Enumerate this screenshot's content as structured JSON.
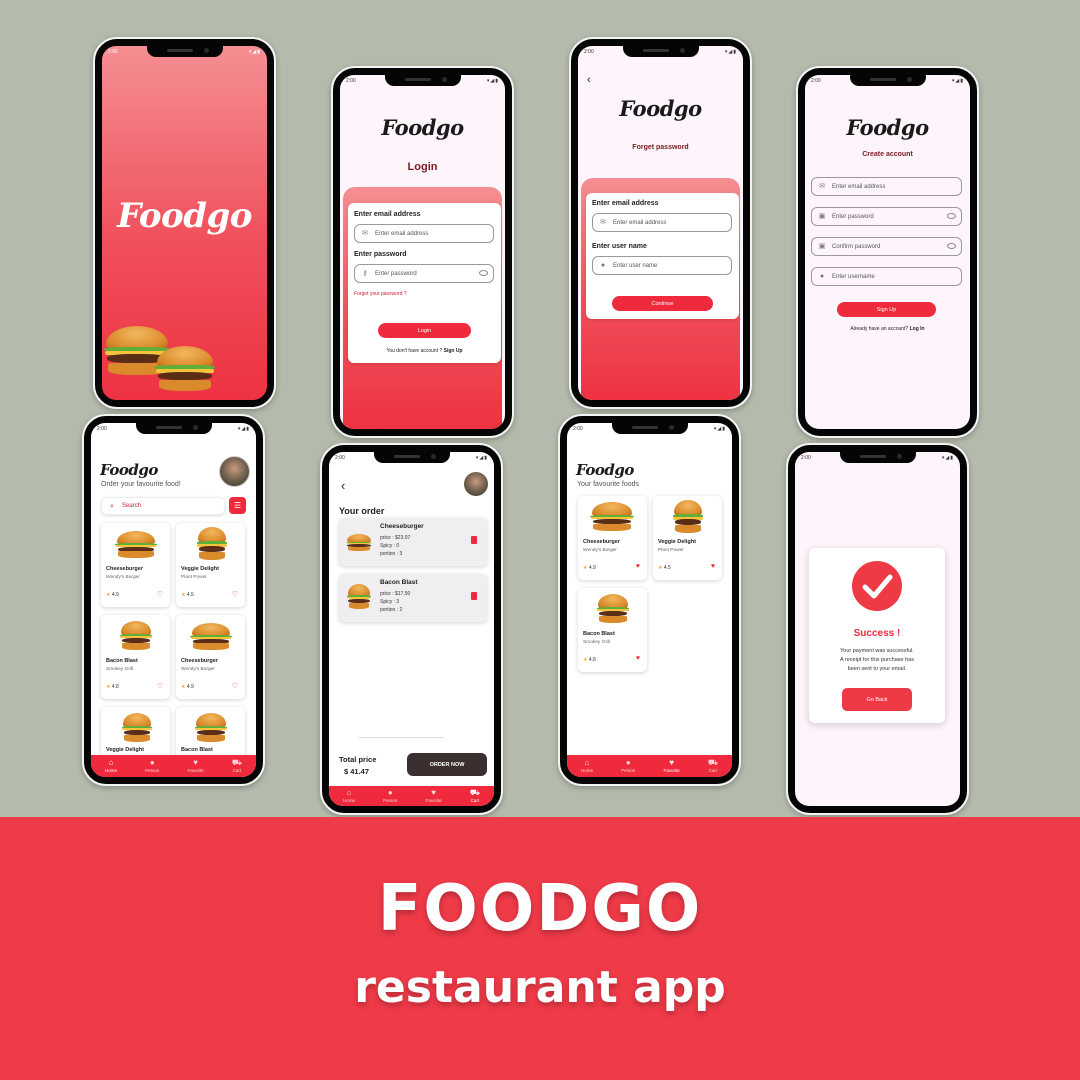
{
  "status_time": "2:00",
  "splash": {
    "logo": "Foodgo"
  },
  "login": {
    "logo": "Foodgo",
    "title": "Login",
    "email_label": "Enter email address",
    "email_placeholder": "Enter email address",
    "password_label": "Enter password",
    "password_placeholder": "Enter password",
    "forgot": "Forget your password ?",
    "button": "Login",
    "no_account": "You don't have account ?",
    "signup": "Sign Up"
  },
  "forget": {
    "logo": "Foodgo",
    "title": "Forget password",
    "email_label": "Enter email address",
    "email_placeholder": "Enter email address",
    "user_label": "Enter user name",
    "user_placeholder": "Enter user name",
    "button": "Continue"
  },
  "signup": {
    "logo": "Foodgo",
    "title": "Create account",
    "email_placeholder": "Enter email address",
    "password_placeholder": "Enter password",
    "confirm_placeholder": "Confirm password",
    "username_placeholder": "Enter username",
    "button": "Sign Up",
    "have_account": "Already have an account?",
    "login": "Log In"
  },
  "home": {
    "logo": "Foodgo",
    "subtitle": "Order your favourite food!",
    "search_placeholder": "Search",
    "items": [
      {
        "name": "Cheeseburger",
        "sub": "Wendy's Burger",
        "rating": "4.9"
      },
      {
        "name": "Veggie Delight",
        "sub": "Plant Power",
        "rating": "4.5"
      },
      {
        "name": "Bacon Blast",
        "sub": "Smokey Grill",
        "rating": "4.8"
      },
      {
        "name": "Cheeseburger",
        "sub": "Wendy's Burger",
        "rating": "4.9"
      },
      {
        "name": "Veggie Delight",
        "sub": ""
      },
      {
        "name": "Bacon Blast",
        "sub": ""
      }
    ]
  },
  "nav": {
    "home": "Home",
    "person": "Person",
    "favorite": "Favorite",
    "cart": "Cart"
  },
  "order": {
    "title": "Your order",
    "items": [
      {
        "name": "Cheeseburger",
        "price": "price : $23.97",
        "spicy": "Spicy : 0",
        "portion": "portion : 3"
      },
      {
        "name": "Bacon Blast",
        "price": "price : $17.50",
        "spicy": "Spicy : 3",
        "portion": "portion : 2"
      }
    ],
    "total_label": "Total price",
    "total_value": "$ 41.47",
    "button": "ORDER NOW"
  },
  "favourites": {
    "logo": "Foodgo",
    "subtitle": "Your favourite foods",
    "items": [
      {
        "name": "Cheeseburger",
        "sub": "Wendy's Burger",
        "rating": "4.9"
      },
      {
        "name": "Veggie Delight",
        "sub": "Plant Power",
        "rating": "4.5"
      },
      {
        "name": "Bacon Blast",
        "sub": "Smokey Grill",
        "rating": "4.8"
      }
    ]
  },
  "success": {
    "title": "Success !",
    "message_1": "Your payment was successful.",
    "message_2": "A receipt for this purchase has",
    "message_3": "been sent to your email.",
    "button": "Go Back"
  },
  "banner": {
    "title": "FOODGO",
    "subtitle": "restaurant app"
  },
  "colors": {
    "primary": "#ee2a3c",
    "background": "#b4bbac",
    "banner": "#ef3a48",
    "dark_button": "#3b2f2f"
  }
}
